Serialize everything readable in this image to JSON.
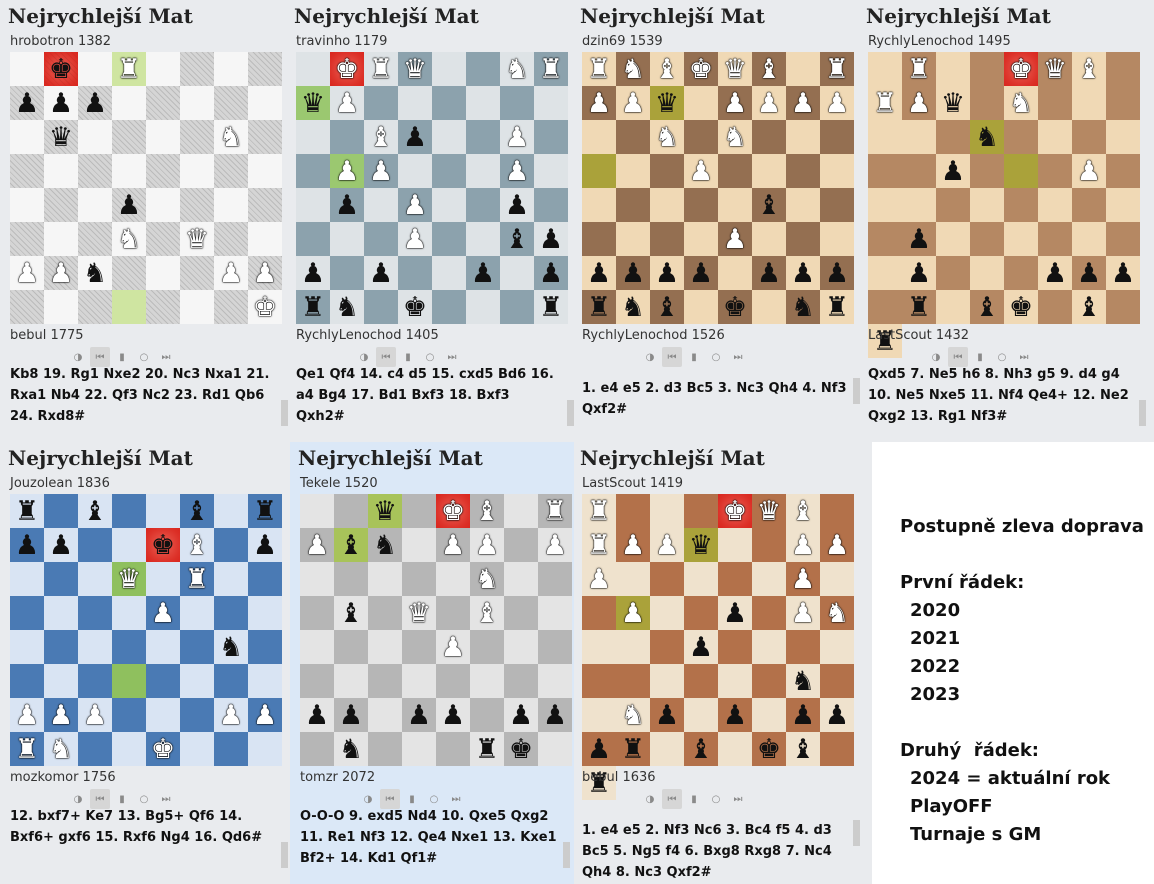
{
  "panels": [
    {
      "title": "Nejrychlejší Mat",
      "top_player": "hrobotron 1382",
      "bottom_player": "bebul 1775",
      "moves": "Kb8 19. Rg1 Nxe2 20. Nc3 Nxa1 21. Rxa1 Nb4 22. Qf3 Nc2 23. Rd1 Qb6 24. Rxd8#",
      "theme": {
        "light": "#f6f6f6",
        "dark": "#d5d5d5",
        "hatch": true,
        "last": "#cfe5a1"
      },
      "fen": "1k1R4/ppp5/1q4N1/8/3p4/3N1Q2/PPn3PP/7K",
      "last_squares": [
        "d8",
        "d1"
      ],
      "check_square": "b8"
    },
    {
      "title": "Nejrychlejší Mat",
      "top_player": "travinho 1179",
      "bottom_player": "RychlyLenochod 1405",
      "moves": "Qe1 Qf4 14. c4 d5 15. cxd5 Bd6 16. a4 Bg4 17. Bd1 Bxf3 18. Bxf3 Qxh2#",
      "theme": {
        "light": "#dee3e6",
        "dark": "#8ca2ad",
        "hatch": false,
        "last": "#9bc870"
      },
      "fen": "1KRQ2NR/qP6/2Bp2P1/1PP3P1/1p1P2p1/3P2bp/p1p2p1p/rn1k3r",
      "last_squares": [
        "a7",
        "b5"
      ],
      "check_square": "b8"
    },
    {
      "title": "Nejrychlejší Mat",
      "top_player": "dzin69 1539",
      "bottom_player": "RychlyLenochod 1526",
      "moves": "1. e4 e5 2. d3 Bc5 3. Nc3 Qh4 4. Nf3 Qxf2#",
      "theme": {
        "light": "#f0d9b5",
        "dark": "#946f51",
        "hatch": false,
        "last": "#aaa23a"
      },
      "fen": "RNBKQB1R/PPq1PPPP/2N1N3/3P4/5b2/4P3/pppp1ppp/rnb1k1nr",
      "last_squares": [
        "c7",
        "a5"
      ],
      "check_square": "e8"
    },
    {
      "title": "Nejrychlejší Mat",
      "top_player": "RychlyLenochod 1495",
      "bottom_player": "LastScout 1432",
      "moves": "Qxd5 7. Ne5 h6 8. Nh3 g5 9. d4 g4 10. Ne5 Nxe5 11. Nf4 Qe4+ 12. Ne2 Qxg2 13. Rg1 Nf3#",
      "theme": {
        "light": "#f0d9b5",
        "dark": "#b58863",
        "hatch": false,
        "last": "#aaa23a"
      },
      "fen": "1R2KQB1R/Pq1N4/2n5/1p3P2/8/p7/p3ppp1/r1bk1b1r",
      "last_squares": [
        "c6",
        "d5"
      ],
      "check_square": "e8"
    },
    {
      "title": "Nejrychlejší Mat",
      "top_player": "Jouzolean 1836",
      "bottom_player": "mozkomor 1756",
      "moves": "12. bxf7+ Ke7 13. Bg5+ Qf6 14. Bxf6+ gxf6 15. Rxf6 Ng4 16. Qd6#",
      "theme": {
        "light": "#d9e4f3",
        "dark": "#4a7ab4",
        "hatch": false,
        "last": "#8fc05e"
      },
      "fen": "r1b2b1r/pp2kB1p/3Q1R2/4P3/6n1/8/PPP3PP/RN2K3",
      "last_squares": [
        "d6",
        "d3"
      ],
      "check_square": "e7"
    },
    {
      "title": "Nejrychlejší Mat",
      "top_player": "Tekele 1520",
      "bottom_player": "tomzr 2072",
      "moves": "O-O-O 9. exd5 Nd4 10. Qxe5 Qxg2 11. Re1 Nf3 12. Qe4 Nxe1 13. Kxe1 Bf2+ 14. Kd1 Qf1#",
      "theme": {
        "light": "#e4e4e4",
        "dark": "#b6b6b6",
        "hatch": false,
        "last": "#a8c35a"
      },
      "fen": "2q1KB1R/Pbn1PP1P/5N2/1b1Q1B2/4P3/8/pp1pp1pp/1n3rk1",
      "last_squares": [
        "c8",
        "b7"
      ],
      "check_square": "e8"
    },
    {
      "title": "Nejrychlejší Mat",
      "top_player": "LastScout 1419",
      "bottom_player": "bebul 1636",
      "moves": "1. e4 e5 2. Nf3 Nc6 3. Bc4 f5 4. d3 Bc5 5. Ng5 f4 6. Bxg8 Rxg8 7. Nc4 Qh4 8. Nc3 Qxf2#",
      "theme": {
        "light": "#efe2cd",
        "dark": "#b3714a",
        "hatch": false,
        "last": "#aaa23a"
      },
      "fen": "R3KQB1R/PPq2PPP/5P2/P2p1PN1/2p5/5n2/Np1p1ppp/r1b1kb1r",
      "last_squares": [
        "c7",
        "a5"
      ],
      "check_square": "e8"
    }
  ],
  "controls": [
    "flip-icon",
    "first-icon",
    "prev-icon",
    "play-icon",
    "next-icon"
  ],
  "legend": {
    "heading": "Postupně zleva doprava",
    "row1_label": "První řádek:",
    "row1_items": [
      "2020",
      "2021",
      "2022",
      "2023"
    ],
    "row2_label": "Druhý  řádek:",
    "row2_items": [
      "2024 = aktuální rok",
      "PlayOFF",
      "Turnaje s GM"
    ]
  }
}
